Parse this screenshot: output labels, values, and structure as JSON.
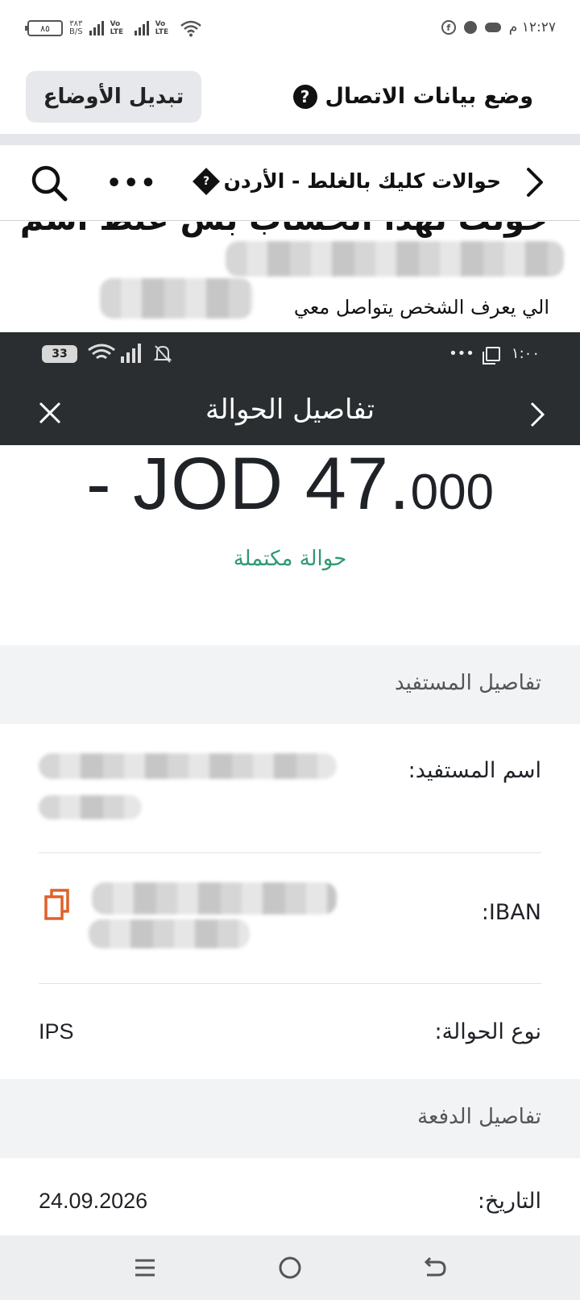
{
  "status_bar": {
    "battery": "٨٥",
    "speed_top": "٣٨٣",
    "speed_bottom": "B/S",
    "volte_1": "Vo LTE",
    "volte_2": "Vo LTE",
    "time": "١٢:٢٧ م"
  },
  "mode_bar": {
    "title": "وضع بيانات الاتصال",
    "switch_button": "تبديل الأوضاع"
  },
  "nav_bar": {
    "group_title": "حوالات كليك بالغلط - الأردن",
    "more": "•••"
  },
  "post": {
    "cut_line": "حولت لهذا الحساب بس غلط اسم",
    "visible_line": "الي يعرف الشخص يتواصل معي"
  },
  "inner_status": {
    "battery": "33",
    "time": "١:٠٠",
    "dots": "•••"
  },
  "inner_header": {
    "title": "تفاصيل الحوالة"
  },
  "transfer": {
    "amount_major": "- JOD 47.",
    "amount_minor": "000",
    "status": "حوالة مكتملة"
  },
  "beneficiary": {
    "section_title": "تفاصيل المستفيد",
    "name_label": "اسم المستفيد:",
    "iban_label": "IBAN:",
    "type_label": "نوع الحوالة:",
    "type_value": "IPS"
  },
  "payment": {
    "section_title": "تفاصيل الدفعة",
    "date_label": "التاريخ:",
    "date_value": "24.09.2026"
  },
  "colors": {
    "accent_green": "#2e9a72",
    "copy_icon": "#e0612a",
    "dark_header": "#2a2e30"
  }
}
